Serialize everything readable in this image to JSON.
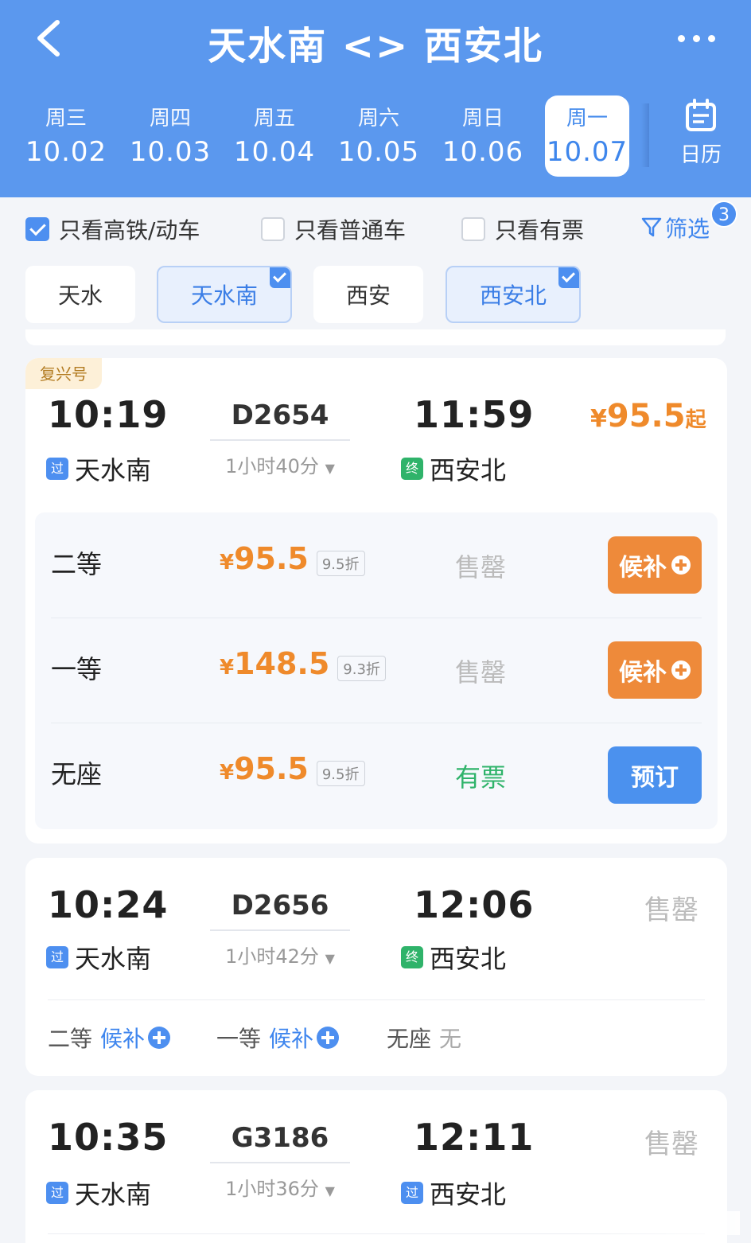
{
  "header": {
    "title": "天水南 <> 西安北",
    "days": [
      {
        "weekday": "周三",
        "date": "10.02"
      },
      {
        "weekday": "周四",
        "date": "10.03"
      },
      {
        "weekday": "周五",
        "date": "10.04"
      },
      {
        "weekday": "周六",
        "date": "10.05"
      },
      {
        "weekday": "周日",
        "date": "10.06"
      },
      {
        "weekday": "周一",
        "date": "10.07",
        "selected": true
      }
    ],
    "calendar_label": "日历",
    "icons": {
      "back": "chevron-left-icon",
      "more": "more-dots-icon",
      "calendar": "calendar-icon"
    }
  },
  "filters": {
    "high_speed": {
      "label": "只看高铁/动车",
      "checked": true
    },
    "normal": {
      "label": "只看普通车",
      "checked": false
    },
    "available": {
      "label": "只看有票",
      "checked": false
    },
    "screen_label": "筛选",
    "screen_badge": "3"
  },
  "stations": [
    {
      "label": "天水",
      "selected": false
    },
    {
      "label": "天水南",
      "selected": true
    },
    {
      "label": "西安",
      "selected": false
    },
    {
      "label": "西安北",
      "selected": true
    }
  ],
  "trains": [
    {
      "tag": "复兴号",
      "dep_time": "10:19",
      "dep_marker": "过",
      "dep_station": "天水南",
      "train_no": "D2654",
      "duration": "1小时40分",
      "arr_time": "11:59",
      "arr_marker": "终",
      "arr_station": "西安北",
      "price_symbol": "¥",
      "price": "95.5",
      "price_suffix": "起",
      "seats": [
        {
          "name": "二等",
          "symbol": "¥",
          "price": "95.5",
          "discount": "9.5折",
          "status": "售罄",
          "action": "候补"
        },
        {
          "name": "一等",
          "symbol": "¥",
          "price": "148.5",
          "discount": "9.3折",
          "status": "售罄",
          "action": "候补"
        },
        {
          "name": "无座",
          "symbol": "¥",
          "price": "95.5",
          "discount": "9.5折",
          "status": "有票",
          "action": "预订"
        }
      ]
    },
    {
      "dep_time": "10:24",
      "dep_marker": "过",
      "dep_station": "天水南",
      "train_no": "D2656",
      "duration": "1小时42分",
      "arr_time": "12:06",
      "arr_marker": "终",
      "arr_station": "西安北",
      "status": "售罄",
      "summary": [
        {
          "name": "二等",
          "value": "候补"
        },
        {
          "name": "一等",
          "value": "候补"
        },
        {
          "name": "无座",
          "value": "无"
        }
      ]
    },
    {
      "dep_time": "10:35",
      "dep_marker": "过",
      "dep_station": "天水南",
      "train_no": "G3186",
      "duration": "1小时36分",
      "arr_time": "12:11",
      "arr_marker": "过",
      "arr_station": "西安北",
      "status": "售罄"
    }
  ],
  "colors": {
    "primary": "#5b98ee",
    "accent": "#ef8a2b",
    "available": "#2fb36a",
    "action_blue": "#4b91ee"
  }
}
